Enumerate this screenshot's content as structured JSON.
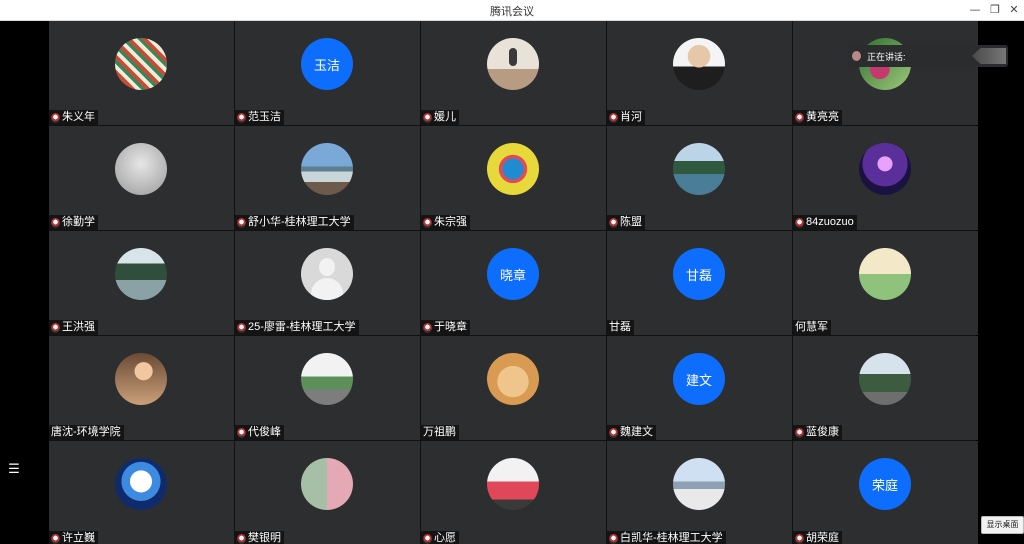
{
  "window": {
    "title": "腾讯会议",
    "minimize_glyph": "—",
    "maximize_glyph": "❐",
    "close_glyph": "✕"
  },
  "sidebar": {
    "menu_icon": "menu-icon",
    "menu_glyph": "☰"
  },
  "speaking": {
    "label": "正在讲话:",
    "icon": "speaker-avatar-icon",
    "arrow": "arrow-icon"
  },
  "buttons": {
    "show_desktop": "显示桌面"
  },
  "participants": [
    {
      "name": "朱义年",
      "avatar_type": "photo",
      "picture": "p-stamp",
      "mic": true
    },
    {
      "name": "范玉洁",
      "avatar_type": "text",
      "avatar_text": "玉洁",
      "mic": true
    },
    {
      "name": "媛儿",
      "avatar_type": "photo",
      "picture": "p-jump",
      "mic": true
    },
    {
      "name": "肖河",
      "avatar_type": "photo",
      "picture": "p-man",
      "mic": true
    },
    {
      "name": "黄亮亮",
      "avatar_type": "photo",
      "picture": "p-flower",
      "mic": true
    },
    {
      "name": "徐勤学",
      "avatar_type": "photo",
      "picture": "p-fog",
      "mic": true
    },
    {
      "name": "舒小华-桂林理工大学",
      "avatar_type": "photo",
      "picture": "p-sea",
      "mic": true
    },
    {
      "name": "朱宗强",
      "avatar_type": "photo",
      "picture": "p-dress",
      "mic": true
    },
    {
      "name": "陈盟",
      "avatar_type": "photo",
      "picture": "p-hills",
      "mic": true
    },
    {
      "name": "84zuozuo",
      "avatar_type": "photo",
      "picture": "p-heart",
      "mic": true
    },
    {
      "name": "王洪强",
      "avatar_type": "photo",
      "picture": "p-river",
      "mic": true
    },
    {
      "name": "25-廖雷-桂林理工大学",
      "avatar_type": "photo",
      "picture": "p-default",
      "mic": true
    },
    {
      "name": "于晓章",
      "avatar_type": "text",
      "avatar_text": "晓章",
      "mic": true
    },
    {
      "name": "甘磊",
      "avatar_type": "text",
      "avatar_text": "甘磊",
      "mic": false
    },
    {
      "name": "何慧军",
      "avatar_type": "photo",
      "picture": "p-cartoon",
      "mic": false
    },
    {
      "name": "唐沈-环境学院",
      "avatar_type": "photo",
      "picture": "p-baby",
      "mic": false
    },
    {
      "name": "代俊峰",
      "avatar_type": "photo",
      "picture": "p-bridge",
      "mic": true
    },
    {
      "name": "万祖鹏",
      "avatar_type": "photo",
      "picture": "p-cat",
      "mic": false
    },
    {
      "name": "魏建文",
      "avatar_type": "text",
      "avatar_text": "建文",
      "mic": true
    },
    {
      "name": "蓝俊康",
      "avatar_type": "photo",
      "picture": "p-tree",
      "mic": true
    },
    {
      "name": "许立巍",
      "avatar_type": "photo",
      "picture": "p-anime",
      "mic": true
    },
    {
      "name": "樊银明",
      "avatar_type": "photo",
      "picture": "p-kids",
      "mic": true
    },
    {
      "name": "心愿",
      "avatar_type": "photo",
      "picture": "p-girl",
      "mic": true
    },
    {
      "name": "白凯华-桂林理工大学",
      "avatar_type": "photo",
      "picture": "p-lake",
      "mic": true
    },
    {
      "name": "胡荣庭",
      "avatar_type": "text",
      "avatar_text": "荣庭",
      "mic": true
    }
  ],
  "colors": {
    "tile_bg": "#2d2e30",
    "avatar_blue": "#0d6efd",
    "titlebar_bg": "#ffffff"
  }
}
